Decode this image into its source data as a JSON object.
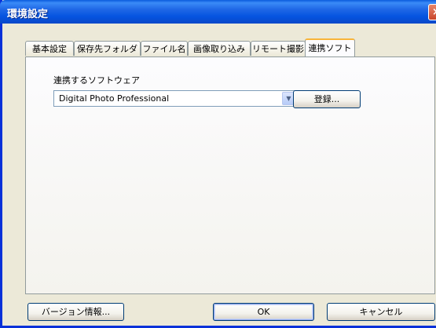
{
  "window": {
    "title": "環境設定",
    "close_label": "×"
  },
  "tabs": [
    {
      "label": "基本設定",
      "active": false
    },
    {
      "label": "保存先フォルダ",
      "active": false
    },
    {
      "label": "ファイル名",
      "active": false
    },
    {
      "label": "画像取り込み",
      "active": false
    },
    {
      "label": "リモート撮影",
      "active": false
    },
    {
      "label": "連携ソフト",
      "active": true
    }
  ],
  "linked_software": {
    "label": "連携するソフトウェア",
    "selected": "Digital Photo Professional",
    "register_button": "登録..."
  },
  "footer": {
    "version_button": "バージョン情報...",
    "ok_button": "OK",
    "cancel_button": "キャンセル"
  },
  "icons": {
    "dropdown": "chevron-down-icon",
    "close": "close-icon"
  }
}
